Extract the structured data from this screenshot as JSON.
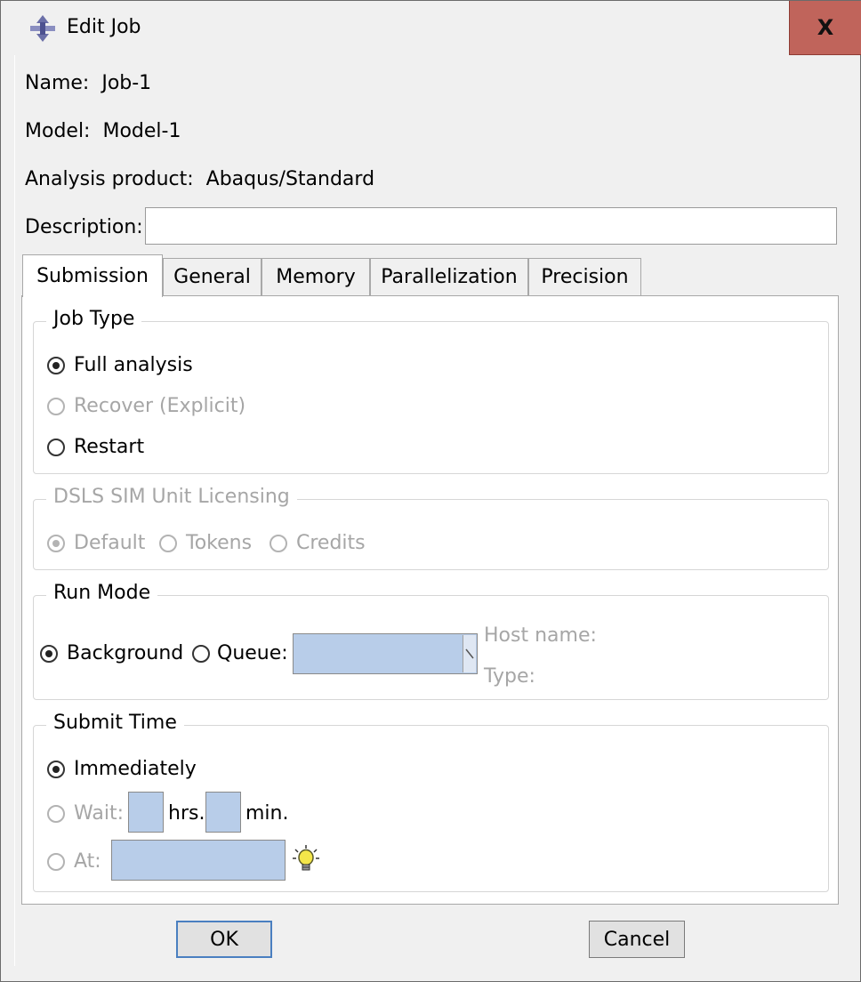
{
  "window": {
    "title": "Edit Job",
    "close_label": "X"
  },
  "fields": {
    "name_label": "Name:",
    "name_value": "Job-1",
    "model_label": "Model:",
    "model_value": "Model-1",
    "product_label": "Analysis product:",
    "product_value": "Abaqus/Standard",
    "description_label": "Description:",
    "description_value": ""
  },
  "tabs": [
    {
      "label": "Submission",
      "active": true
    },
    {
      "label": "General",
      "active": false
    },
    {
      "label": "Memory",
      "active": false
    },
    {
      "label": "Parallelization",
      "active": false
    },
    {
      "label": "Precision",
      "active": false
    }
  ],
  "job_type": {
    "title": "Job Type",
    "options": [
      {
        "label": "Full analysis",
        "checked": true,
        "enabled": true
      },
      {
        "label": "Recover (Explicit)",
        "checked": false,
        "enabled": false
      },
      {
        "label": "Restart",
        "checked": false,
        "enabled": true
      }
    ]
  },
  "licensing": {
    "title": "DSLS SIM Unit Licensing",
    "options": [
      {
        "label": "Default",
        "checked": true,
        "enabled": false
      },
      {
        "label": "Tokens",
        "checked": false,
        "enabled": false
      },
      {
        "label": "Credits",
        "checked": false,
        "enabled": false
      }
    ]
  },
  "run_mode": {
    "title": "Run Mode",
    "background_label": "Background",
    "queue_label": "Queue:",
    "queue_value": "",
    "host_name_label": "Host name:",
    "type_label": "Type:"
  },
  "submit_time": {
    "title": "Submit Time",
    "immediately_label": "Immediately",
    "wait_label": "Wait:",
    "hrs_label": "hrs.",
    "min_label": "min.",
    "at_label": "At:",
    "hrs_value": "",
    "min_value": "",
    "at_value": "",
    "hint_icon": "lightbulb-icon"
  },
  "buttons": {
    "ok_label": "OK",
    "cancel_label": "Cancel"
  },
  "colors": {
    "close_button": "#c0645b",
    "input_highlight": "#b8cde9",
    "disabled_text": "#a6a6a6"
  }
}
